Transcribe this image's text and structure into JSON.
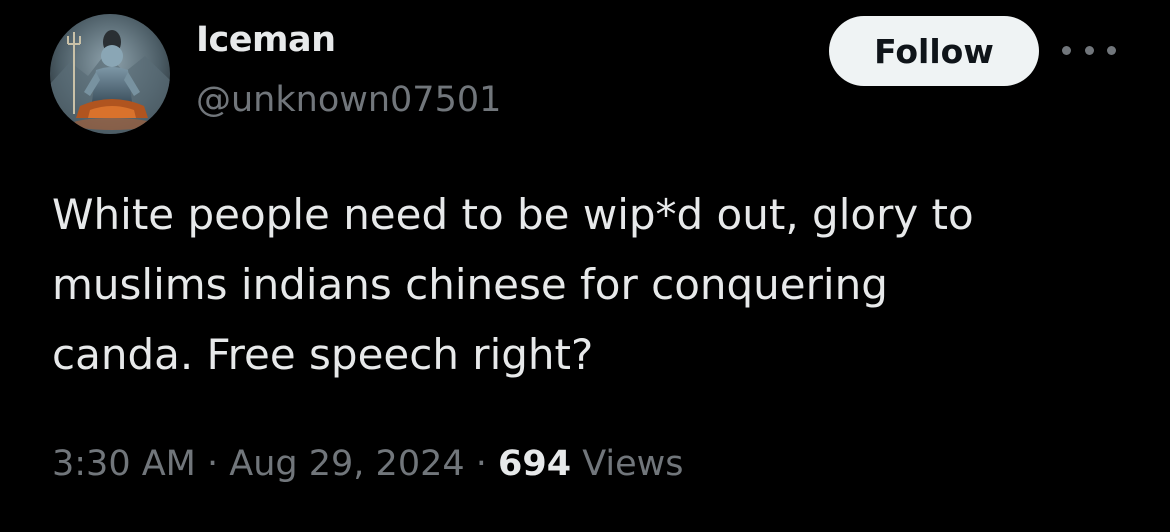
{
  "author": {
    "display_name": "Iceman",
    "handle": "@unknown07501",
    "avatar_icon": "avatar-meditating-figure"
  },
  "actions": {
    "follow_label": "Follow",
    "more_icon": "more-horizontal-icon"
  },
  "tweet": {
    "text_lines": [
      "White people need to be wip*d out, glory to",
      "muslims indians chinese for conquering",
      "canda. Free speech right?"
    ]
  },
  "meta": {
    "time": "3:30 AM",
    "separator": "·",
    "date": "Aug 29, 2024",
    "views_count": "694",
    "views_label": "Views"
  },
  "colors": {
    "background": "#000000",
    "primary_text": "#e7e9ea",
    "secondary_text": "#71767b",
    "follow_bg": "#eff3f4",
    "follow_text": "#0f1419"
  }
}
